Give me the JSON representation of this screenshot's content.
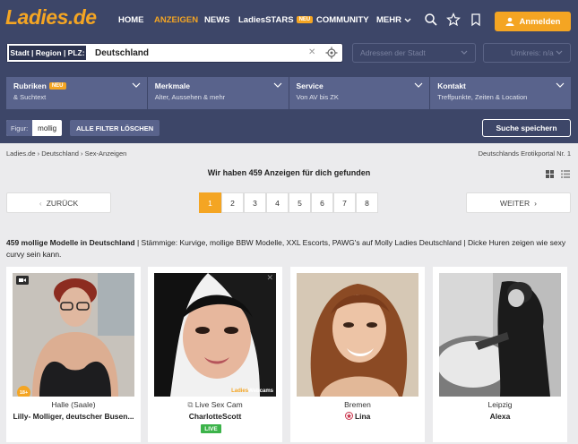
{
  "brand": {
    "logo": "Ladies.de",
    "accent": "#f4a523",
    "header_bg": "#3d4668",
    "panel_bg": "#59638c"
  },
  "nav": [
    {
      "label": "HOME",
      "active": false
    },
    {
      "label": "ANZEIGEN",
      "active": true
    },
    {
      "label": "NEWS",
      "active": false
    },
    {
      "label": "LadiesSTARS",
      "active": false,
      "badge": "NEU"
    },
    {
      "label": "COMMUNITY",
      "active": false
    },
    {
      "label": "MEHR",
      "active": false
    }
  ],
  "header_icons": [
    "search-icon",
    "star-icon",
    "bookmark-icon"
  ],
  "login": {
    "label": "Anmelden",
    "icon": "user-icon"
  },
  "search": {
    "label": "Stadt | Region | PLZ:",
    "value": "Deutschland",
    "address_placeholder": "Adressen der Stadt",
    "radius_placeholder": "Umkreis: n/a"
  },
  "filters": [
    {
      "title": "Rubriken",
      "badge": "NEU",
      "subtitle": "& Suchtext"
    },
    {
      "title": "Merkmale",
      "subtitle": "Alter, Aussehen & mehr"
    },
    {
      "title": "Service",
      "subtitle": "Von AV bis ZK"
    },
    {
      "title": "Kontakt",
      "subtitle": "Treffpunkte, Zeiten & Location"
    }
  ],
  "active_filter": {
    "label": "Figur:",
    "value": "mollig"
  },
  "clear_filters": "ALLE FILTER LÖSCHEN",
  "save_search": "Suche speichern",
  "breadcrumb": [
    "Ladies.de",
    "Deutschland",
    "Sex-Anzeigen"
  ],
  "breadcrumb_sep": "›",
  "tagline": "Deutschlands Erotikportal Nr. 1",
  "found_text": "Wir haben 459 Anzeigen für dich gefunden",
  "pagination": {
    "prev": "ZURÜCK",
    "next": "WEITER",
    "pages": [
      "1",
      "2",
      "3",
      "4",
      "5",
      "6",
      "7",
      "8"
    ],
    "current": "1"
  },
  "description": {
    "bold": "459 mollige Modelle in Deutschland",
    "text": " | Stämmige: Kurvige, mollige BBW Modelle, XXL Escorts, PAWG's auf Molly Ladies Deutschland | Dicke Huren zeigen wie sexy curvy sein kann."
  },
  "cards": [
    {
      "city": "Halle (Saale)",
      "name": "Lilly- Molliger, deutscher Busen...",
      "badge": "18+",
      "icon": "video-icon"
    },
    {
      "city": "Live Sex Cam",
      "name": "CharlotteScott",
      "status": "LIVE",
      "icon": "external-link-icon",
      "watermark_a": "Ladies",
      "watermark_b": "Webcams"
    },
    {
      "city": "Bremen",
      "name": "Lina",
      "icon": "star-badge-icon"
    },
    {
      "city": "Leipzig",
      "name": "Alexa"
    }
  ]
}
